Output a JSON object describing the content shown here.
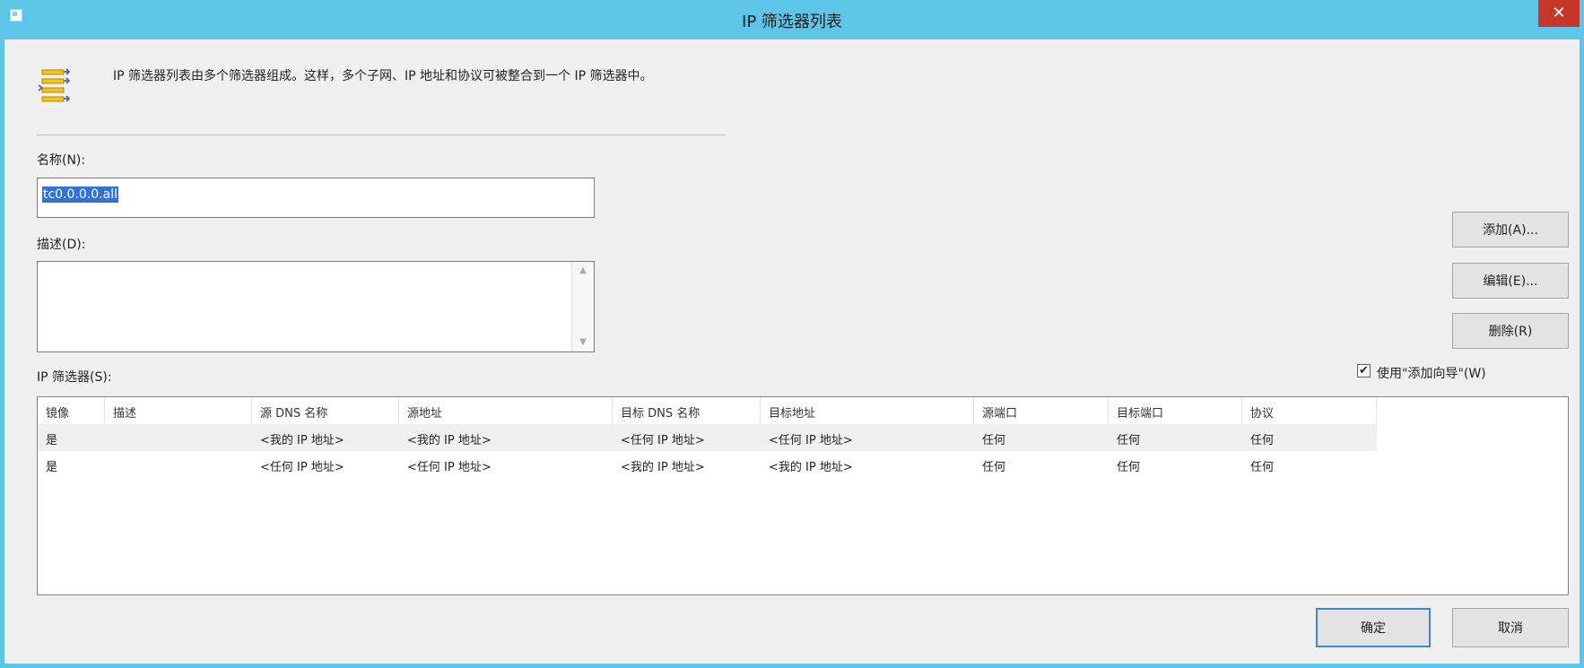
{
  "window": {
    "title": "IP 筛选器列表"
  },
  "info": {
    "text": "IP 筛选器列表由多个筛选器组成。这样，多个子网、IP 地址和协议可被整合到一个 IP 筛选器中。"
  },
  "name": {
    "label": "名称(N):",
    "value": "tc0.0.0.0.all"
  },
  "description": {
    "label": "描述(D):",
    "value": ""
  },
  "filters_label": "IP 筛选器(S):",
  "buttons": {
    "add": "添加(A)...",
    "edit": "编辑(E)...",
    "delete": "删除(R)",
    "ok": "确定",
    "cancel": "取消"
  },
  "wizard": {
    "label": "使用\"添加向导\"(W)",
    "checked": true
  },
  "table": {
    "columns": [
      "镜像",
      "描述",
      "源 DNS 名称",
      "源地址",
      "目标 DNS 名称",
      "目标地址",
      "源端口",
      "目标端口",
      "协议"
    ],
    "rows": [
      [
        "是",
        "",
        "<我的 IP 地址>",
        "<我的 IP 地址>",
        "<任何 IP 地址>",
        "<任何 IP 地址>",
        "任何",
        "任何",
        "任何"
      ],
      [
        "是",
        "",
        "<任何 IP 地址>",
        "<任何 IP 地址>",
        "<我的 IP 地址>",
        "<我的 IP 地址>",
        "任何",
        "任何",
        "任何"
      ]
    ]
  },
  "colors": {
    "titlebar": "#5cc5e8",
    "selection": "#3072d8",
    "close": "#c7362b"
  }
}
